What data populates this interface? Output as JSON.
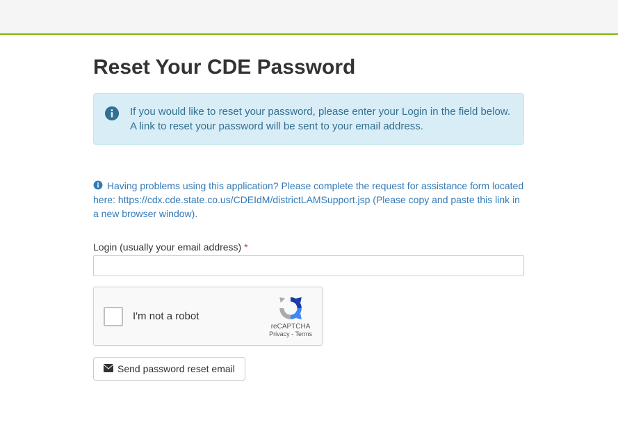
{
  "page": {
    "title": "Reset Your CDE Password"
  },
  "alert": {
    "message": "If you would like to reset your password, please enter your Login in the field below. A link to reset your password will be sent to your email address."
  },
  "help": {
    "prefix": "Having problems using this application? Please complete the request for assistance form located here: ",
    "link": "https://cdx.cde.state.co.us/CDEIdM/districtLAMSupport.jsp",
    "suffix": " (Please copy and paste this link in a new browser window)."
  },
  "form": {
    "login_label": "Login (usually your email address)",
    "required_mark": "*",
    "login_value": ""
  },
  "recaptcha": {
    "label": "I'm not a robot",
    "brand": "reCAPTCHA",
    "privacy": "Privacy",
    "separator": " - ",
    "terms": "Terms"
  },
  "submit": {
    "label": "Send password reset email"
  }
}
